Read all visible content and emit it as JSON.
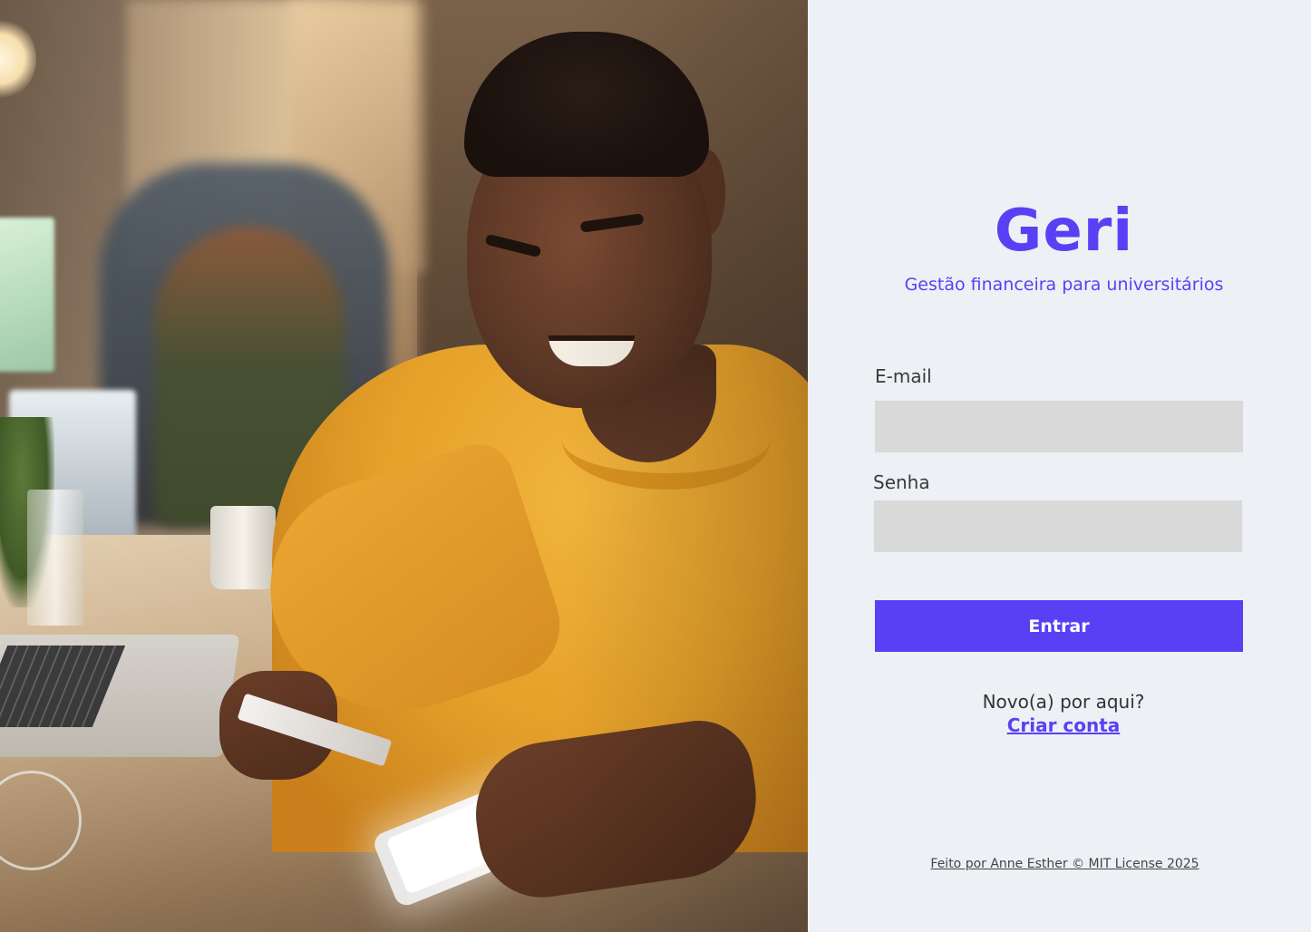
{
  "hero": {
    "image_alt": "Jovem sorridente de suéter amarelo segurando um cartão e usando o celular"
  },
  "brand": {
    "logo": "Geri",
    "tagline": "Gestão financeira para universitários",
    "accent_color": "#5a40f5"
  },
  "form": {
    "email_label": "E-mail",
    "email_value": "",
    "password_label": "Senha",
    "password_value": "",
    "submit_label": "Entrar"
  },
  "signup": {
    "prompt": "Novo(a) por aqui?",
    "link_label": "Criar conta"
  },
  "footer": {
    "text": "Feito por Anne Esther © MIT License 2025"
  }
}
